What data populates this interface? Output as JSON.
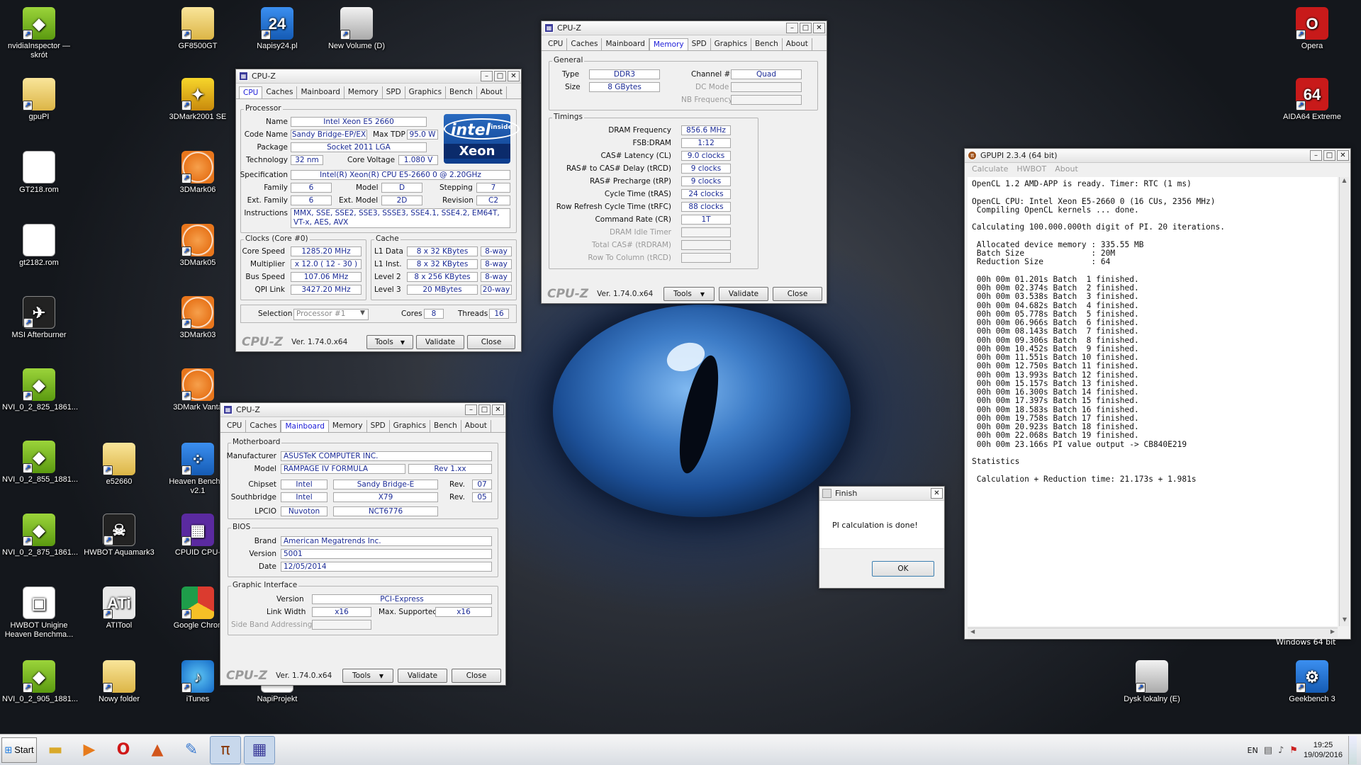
{
  "desktop_icons": [
    {
      "id": "nvidia-inspector",
      "label": "nvidiaInspector — skrót",
      "glyph": "◆",
      "style": "g-nv",
      "icon": "nvidia-icon"
    },
    {
      "id": "gpupi",
      "label": "gpuPI",
      "glyph": "",
      "style": "g-folder",
      "icon": "folder-icon"
    },
    {
      "id": "gt218",
      "label": "GT218.rom",
      "glyph": "",
      "style": "g-file",
      "icon": "file-icon"
    },
    {
      "id": "gt2182",
      "label": "gt2182.rom",
      "glyph": "",
      "style": "g-file",
      "icon": "file-icon"
    },
    {
      "id": "msi-afterburner",
      "label": "MSI Afterburner",
      "glyph": "✈",
      "style": "g-dark",
      "icon": "afterburner-icon"
    },
    {
      "id": "nvi-825",
      "label": "NVI_0_2_825_1861...",
      "glyph": "◆",
      "style": "g-nv",
      "icon": "nvidia-icon"
    },
    {
      "id": "nvi-855",
      "label": "NVI_0_2_855_1881...",
      "glyph": "◆",
      "style": "g-nv",
      "icon": "nvidia-icon"
    },
    {
      "id": "nvi-875",
      "label": "NVI_0_2_875_1861...",
      "glyph": "◆",
      "style": "g-nv",
      "icon": "nvidia-icon"
    },
    {
      "id": "hwbot-unigine",
      "label": "HWBOT Unigine Heaven Benchma...",
      "glyph": "▣",
      "style": "g-file",
      "icon": "unigine-icon"
    },
    {
      "id": "nvi-905",
      "label": "NVI_0_2_905_1881...",
      "glyph": "◆",
      "style": "g-nv",
      "icon": "nvidia-icon"
    },
    {
      "id": "gf8500gt",
      "label": "GF8500GT",
      "glyph": "",
      "style": "g-folder",
      "icon": "folder-icon"
    },
    {
      "id": "3dmark2001",
      "label": "3DMark2001 SE",
      "glyph": "✦",
      "style": "g-yellow",
      "icon": "3dmark-icon"
    },
    {
      "id": "3dmark06",
      "label": "3DMark06",
      "glyph": "",
      "style": "g-3dm",
      "icon": "3dmark-icon"
    },
    {
      "id": "3dmark05",
      "label": "3DMark05",
      "glyph": "",
      "style": "g-3dm",
      "icon": "3dmark-icon"
    },
    {
      "id": "3dmark03",
      "label": "3DMark03",
      "glyph": "",
      "style": "g-3dm",
      "icon": "3dmark-icon"
    },
    {
      "id": "3dmark-vantage",
      "label": "3DMark Vanta",
      "glyph": "",
      "style": "g-3dm",
      "icon": "3dmark-icon"
    },
    {
      "id": "e52660",
      "label": "e52660",
      "glyph": "",
      "style": "g-folder",
      "icon": "folder-icon"
    },
    {
      "id": "hwbot-aquamark",
      "label": "HWBOT Aquamark3",
      "glyph": "☠",
      "style": "g-dark",
      "icon": "aquamark-icon"
    },
    {
      "id": "atitool",
      "label": "ATITool",
      "glyph": "ATi",
      "style": "g-x",
      "icon": "atitool-icon"
    },
    {
      "id": "nowy-folder",
      "label": "Nowy folder",
      "glyph": "",
      "style": "g-folder",
      "icon": "folder-icon"
    },
    {
      "id": "napisy24",
      "label": "Napisy24.pl",
      "glyph": "24",
      "style": "g-blue",
      "icon": "napisy-icon"
    },
    {
      "id": "new-volume",
      "label": "New Volume (D)",
      "glyph": "",
      "style": "g-drive",
      "icon": "drive-icon"
    },
    {
      "id": "heaven",
      "label": "Heaven Benchm v2.1",
      "glyph": "⁘",
      "style": "g-blue",
      "icon": "heaven-icon"
    },
    {
      "id": "cpuid-cpu",
      "label": "CPUID CPU-",
      "glyph": "▦",
      "style": "g-purple",
      "icon": "cpuid-icon"
    },
    {
      "id": "google-chrome",
      "label": "Google Chron",
      "glyph": "",
      "style": "g-chrome",
      "icon": "chrome-icon"
    },
    {
      "id": "itunes",
      "label": "iTunes",
      "glyph": "♪",
      "style": "g-itunes",
      "icon": "itunes-icon"
    },
    {
      "id": "napiprojekt",
      "label": "NapiProjekt",
      "glyph": "",
      "style": "g-file",
      "icon": "napiprojekt-icon"
    },
    {
      "id": "opera",
      "label": "Opera",
      "glyph": "O",
      "style": "g-red",
      "icon": "opera-icon"
    },
    {
      "id": "aida64",
      "label": "AIDA64 Extreme",
      "glyph": "64",
      "style": "g-aida",
      "icon": "aida64-icon"
    },
    {
      "id": "dysk-lokalny",
      "label": "Dysk lokalny (E)",
      "glyph": "",
      "style": "g-drive",
      "icon": "drive-icon"
    },
    {
      "id": "geekbench",
      "label": "Geekbench 3",
      "glyph": "⚙",
      "style": "g-blue",
      "icon": "geekbench-icon"
    }
  ],
  "cpuz_tabs": [
    "CPU",
    "Caches",
    "Mainboard",
    "Memory",
    "SPD",
    "Graphics",
    "Bench",
    "About"
  ],
  "cpuz_common": {
    "title": "CPU-Z",
    "logo": "CPU-Z",
    "version": "Ver. 1.74.0.x64",
    "tools": "Tools",
    "validate": "Validate",
    "close": "Close"
  },
  "cpu": {
    "processor_group": "Processor",
    "name_l": "Name",
    "name": "Intel Xeon E5 2660",
    "codename_l": "Code Name",
    "codename": "Sandy Bridge-EP/EX",
    "maxtdp_l": "Max TDP",
    "maxtdp": "95.0 W",
    "package_l": "Package",
    "package": "Socket 2011 LGA",
    "tech_l": "Technology",
    "tech": "32 nm",
    "voltage_l": "Core Voltage",
    "voltage": "1.080 V",
    "spec_l": "Specification",
    "spec": "Intel(R) Xeon(R) CPU E5-2660 0 @ 2.20GHz",
    "family_l": "Family",
    "family": "6",
    "model_l": "Model",
    "model": "D",
    "stepping_l": "Stepping",
    "stepping": "7",
    "extfamily_l": "Ext. Family",
    "extfamily": "6",
    "extmodel_l": "Ext. Model",
    "extmodel": "2D",
    "revision_l": "Revision",
    "revision": "C2",
    "instr_l": "Instructions",
    "instr": "MMX, SSE, SSE2, SSE3, SSSE3, SSE4.1, SSE4.2, EM64T, VT-x, AES, AVX",
    "intel_inside": "intel",
    "intel_inside_sub": "inside",
    "xeon": "Xeon",
    "clocks_group": "Clocks (Core #0)",
    "corespeed_l": "Core Speed",
    "corespeed": "1285.20 MHz",
    "mult_l": "Multiplier",
    "mult": "x 12.0 ( 12 - 30 )",
    "bus_l": "Bus Speed",
    "bus": "107.06 MHz",
    "qpi_l": "QPI Link",
    "qpi": "3427.20 MHz",
    "cache_group": "Cache",
    "l1d_l": "L1 Data",
    "l1d": "8 x 32 KBytes",
    "l1d_w": "8-way",
    "l1i_l": "L1 Inst.",
    "l1i": "8 x 32 KBytes",
    "l1i_w": "8-way",
    "l2_l": "Level 2",
    "l2": "8 x 256 KBytes",
    "l2_w": "8-way",
    "l3_l": "Level 3",
    "l3": "20 MBytes",
    "l3_w": "20-way",
    "selection_l": "Selection",
    "selection": "Processor #1",
    "cores_l": "Cores",
    "cores": "8",
    "threads_l": "Threads",
    "threads": "16"
  },
  "memory": {
    "general_group": "General",
    "type_l": "Type",
    "type": "DDR3",
    "size_l": "Size",
    "size": "8 GBytes",
    "channel_l": "Channel #",
    "channel": "Quad",
    "dcmode_l": "DC Mode",
    "nbfreq_l": "NB Frequency",
    "timings_group": "Timings",
    "timings": [
      {
        "l": "DRAM Frequency",
        "v": "856.6 MHz",
        "dim": false
      },
      {
        "l": "FSB:DRAM",
        "v": "1:12",
        "dim": false
      },
      {
        "l": "CAS# Latency (CL)",
        "v": "9.0 clocks",
        "dim": false
      },
      {
        "l": "RAS# to CAS# Delay (tRCD)",
        "v": "9 clocks",
        "dim": false
      },
      {
        "l": "RAS# Precharge (tRP)",
        "v": "9 clocks",
        "dim": false
      },
      {
        "l": "Cycle Time (tRAS)",
        "v": "24 clocks",
        "dim": false
      },
      {
        "l": "Row Refresh Cycle Time (tRFC)",
        "v": "88 clocks",
        "dim": false
      },
      {
        "l": "Command Rate (CR)",
        "v": "1T",
        "dim": false
      },
      {
        "l": "DRAM Idle Timer",
        "v": "",
        "dim": true
      },
      {
        "l": "Total CAS# (tRDRAM)",
        "v": "",
        "dim": true
      },
      {
        "l": "Row To Column (tRCD)",
        "v": "",
        "dim": true
      }
    ]
  },
  "mainboard": {
    "mb_group": "Motherboard",
    "manuf_l": "Manufacturer",
    "manuf": "ASUSTeK COMPUTER INC.",
    "model_l": "Model",
    "model": "RAMPAGE IV FORMULA",
    "model_rev": "Rev 1.xx",
    "chipset_l": "Chipset",
    "chipset_v": "Intel",
    "chipset_n": "Sandy Bridge-E",
    "chipset_rev_l": "Rev.",
    "chipset_rev": "07",
    "south_l": "Southbridge",
    "south_v": "Intel",
    "south_n": "X79",
    "south_rev_l": "Rev.",
    "south_rev": "05",
    "lpcio_l": "LPCIO",
    "lpcio_v": "Nuvoton",
    "lpcio_n": "NCT6776",
    "bios_group": "BIOS",
    "brand_l": "Brand",
    "brand": "American Megatrends Inc.",
    "version_l": "Version",
    "version": "5001",
    "date_l": "Date",
    "date": "12/05/2014",
    "gi_group": "Graphic Interface",
    "gi_version_l": "Version",
    "gi_version": "PCI-Express",
    "gi_lw_l": "Link Width",
    "gi_lw": "x16",
    "gi_max_l": "Max. Supported",
    "gi_max": "x16",
    "gi_sba_l": "Side Band Addressing"
  },
  "gpupi": {
    "title": "GPUPI 2.3.4 (64 bit)",
    "menu": [
      "Calculate",
      "HWBOT",
      "About"
    ],
    "output": "OpenCL 1.2 AMD-APP is ready. Timer: RTC (1 ms)\n\nOpenCL CPU: Intel Xeon E5-2660 0 (16 CUs, 2356 MHz)\n Compiling OpenCL kernels ... done.\n\nCalculating 100.000.000th digit of PI. 20 iterations.\n\n Allocated device memory : 335.55 MB\n Batch Size              : 20M\n Reduction Size          : 64\n\n 00h 00m 01.201s Batch  1 finished.\n 00h 00m 02.374s Batch  2 finished.\n 00h 00m 03.538s Batch  3 finished.\n 00h 00m 04.682s Batch  4 finished.\n 00h 00m 05.778s Batch  5 finished.\n 00h 00m 06.966s Batch  6 finished.\n 00h 00m 08.143s Batch  7 finished.\n 00h 00m 09.306s Batch  8 finished.\n 00h 00m 10.452s Batch  9 finished.\n 00h 00m 11.551s Batch 10 finished.\n 00h 00m 12.750s Batch 11 finished.\n 00h 00m 13.993s Batch 12 finished.\n 00h 00m 15.157s Batch 13 finished.\n 00h 00m 16.300s Batch 14 finished.\n 00h 00m 17.397s Batch 15 finished.\n 00h 00m 18.583s Batch 16 finished.\n 00h 00m 19.758s Batch 17 finished.\n 00h 00m 20.923s Batch 18 finished.\n 00h 00m 22.068s Batch 19 finished.\n 00h 00m 23.166s PI value output -> CB840E219\n\nStatistics\n\n Calculation + Reduction time: 21.173s + 1.981s"
  },
  "finish_dialog": {
    "title": "Finish",
    "message": "PI calculation is done!",
    "ok": "OK"
  },
  "taskbar": {
    "start": "Start",
    "lang": "EN",
    "time": "19:25",
    "date": "19/09/2016"
  },
  "behind_text": "Windows 64 bit"
}
